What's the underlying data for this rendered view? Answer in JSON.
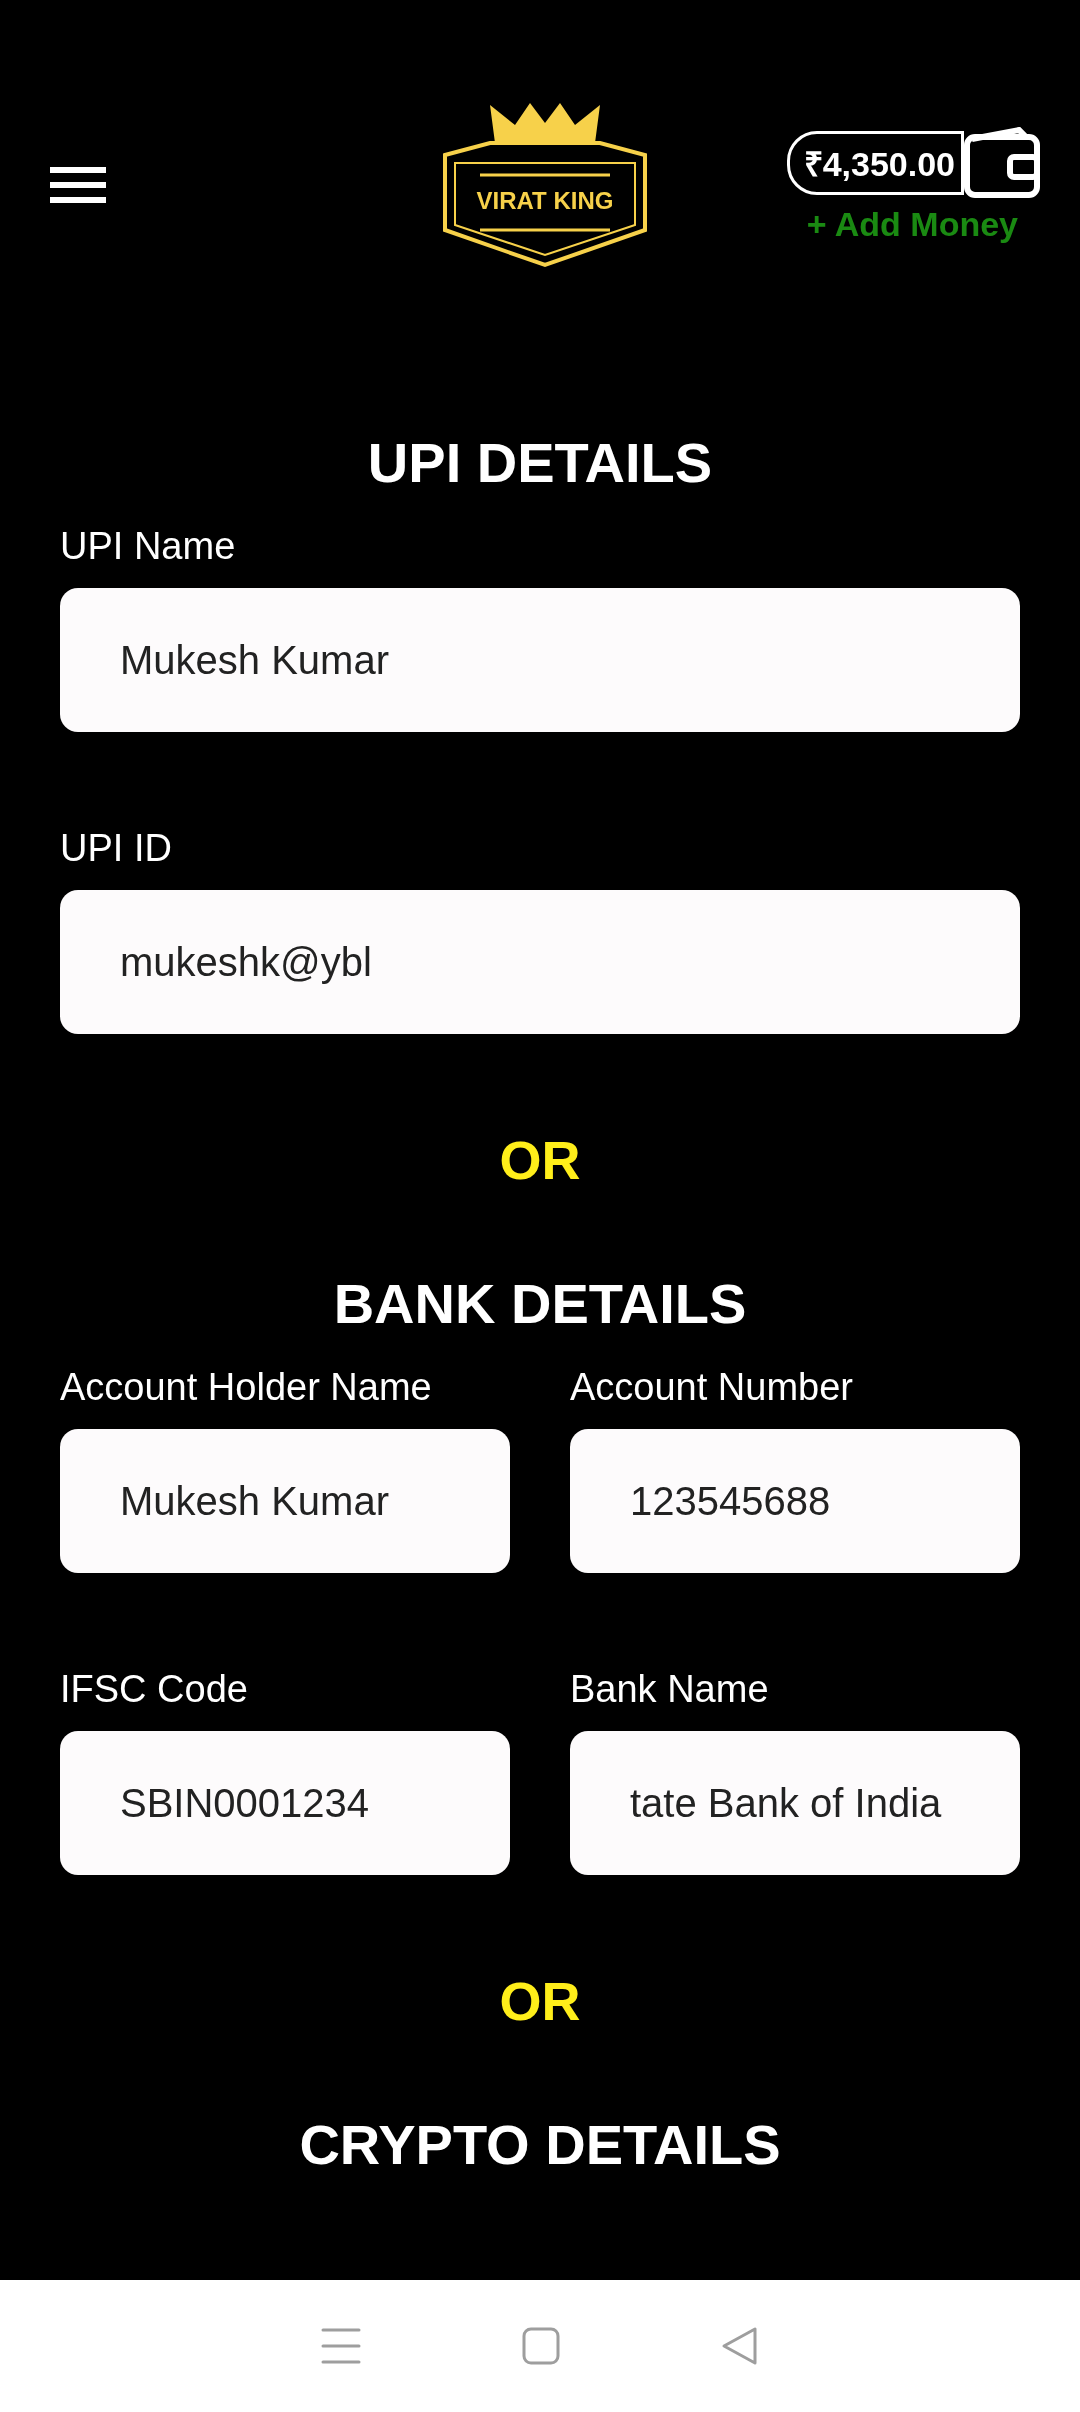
{
  "header": {
    "logo_text": "VIRAT KING",
    "balance": "₹4,350.00",
    "add_money": "+ Add Money"
  },
  "sections": [
    {
      "kind": "section",
      "title": "UPI DETAILS",
      "rows": [
        [
          {
            "label": "UPI Name",
            "value": "Mukesh Kumar"
          }
        ],
        [
          {
            "label": "UPI ID",
            "value": "mukeshk@ybl"
          }
        ]
      ]
    },
    {
      "kind": "separator",
      "title": "OR"
    },
    {
      "kind": "section",
      "title": "BANK DETAILS",
      "rows": [
        [
          {
            "label": "Account Holder Name",
            "value": "Mukesh Kumar"
          },
          {
            "label": "Account Number",
            "value": "123545688"
          }
        ],
        [
          {
            "label": "IFSC Code",
            "value": "SBIN0001234"
          },
          {
            "label": "Bank Name",
            "value": "tate Bank of India"
          }
        ]
      ]
    },
    {
      "kind": "separator",
      "title": "OR"
    },
    {
      "kind": "section",
      "title": "CRYPTO DETAILS"
    }
  ]
}
